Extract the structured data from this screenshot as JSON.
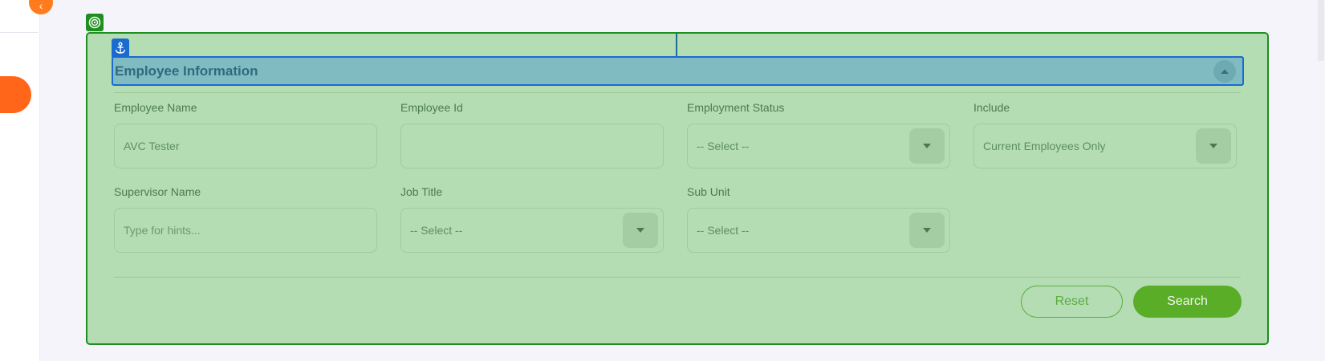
{
  "section": {
    "title": "Employee Information"
  },
  "fields": {
    "employee_name": {
      "label": "Employee Name",
      "value": "AVC Tester"
    },
    "employee_id": {
      "label": "Employee Id",
      "value": ""
    },
    "employment_status": {
      "label": "Employment Status",
      "value": "-- Select --"
    },
    "include": {
      "label": "Include",
      "value": "Current Employees Only"
    },
    "supervisor_name": {
      "label": "Supervisor Name",
      "placeholder": "Type for hints..."
    },
    "job_title": {
      "label": "Job Title",
      "value": "-- Select --"
    },
    "sub_unit": {
      "label": "Sub Unit",
      "value": "-- Select --"
    }
  },
  "actions": {
    "reset_label": "Reset",
    "search_label": "Search"
  },
  "colors": {
    "accent": "#5aad27",
    "sidebar_accent": "#ff5500",
    "highlight_green": "#1f8f1f",
    "highlight_blue": "#1a6bd0"
  },
  "icons": {
    "collapse_sidebar": "chevron-left-icon",
    "target": "target-icon",
    "anchor": "anchor-icon",
    "section_toggle": "chevron-up-icon",
    "dropdown": "caret-down-icon"
  }
}
